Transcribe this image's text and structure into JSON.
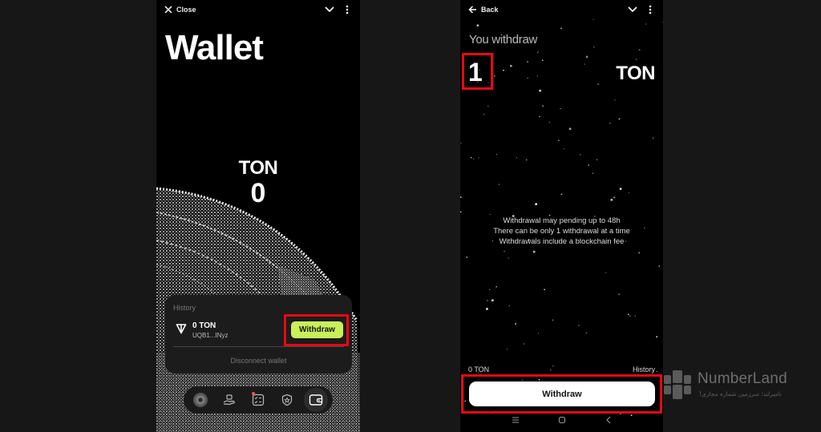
{
  "left_screen": {
    "topbar": {
      "close_label": "Close",
      "close_icon": "close-icon",
      "collapse_icon": "chevron-down-icon",
      "menu_icon": "more-vertical-icon"
    },
    "title": "Wallet",
    "balance": {
      "currency": "TON",
      "amount": "0"
    },
    "wallet_card": {
      "history_label": "History",
      "token_icon": "ton-logo-icon",
      "amount": "0 TON",
      "address": "UQB1...INyz",
      "withdraw_label": "Withdraw",
      "withdraw_color": "#c9ef59",
      "disconnect_label": "Disconnect wallet"
    },
    "bottom_nav": [
      {
        "icon": "avatar-icon",
        "active": false
      },
      {
        "icon": "hand-gift-icon",
        "active": false
      },
      {
        "icon": "tasks-checklist-icon",
        "active": false,
        "badge": true
      },
      {
        "icon": "shield-star-icon",
        "active": false
      },
      {
        "icon": "wallet-icon",
        "active": true
      }
    ]
  },
  "right_screen": {
    "topbar": {
      "back_label": "Back",
      "back_icon": "arrow-left-icon",
      "collapse_icon": "chevron-down-icon",
      "menu_icon": "more-vertical-icon"
    },
    "heading": "You withdraw",
    "amount": "1",
    "currency": "TON",
    "notes": [
      "Withdrawal may pending up to 48h",
      "There can be only 1 withdrawal at a time",
      "Withdrawals include a blockchain fee"
    ],
    "balance_label": "0 TON",
    "history_label": "History",
    "withdraw_label": "Withdraw",
    "system_nav": [
      "recents-icon",
      "home-icon",
      "back-icon"
    ]
  },
  "annotations": {
    "highlight_color": "#e50914"
  },
  "watermark": {
    "name": "NumberLand",
    "tagline": "نامبرلند؛ سرزمین شماره مجازی!"
  }
}
